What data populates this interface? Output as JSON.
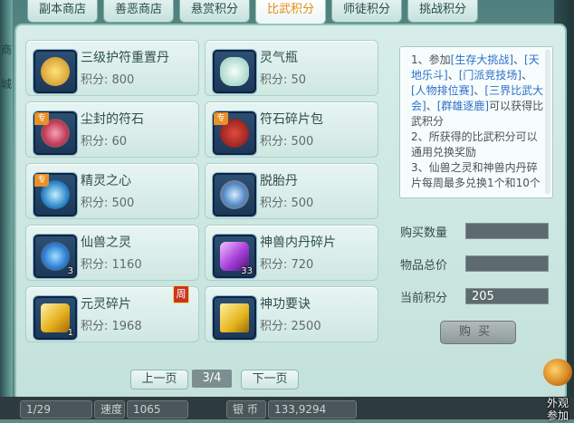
{
  "tabs": [
    "副本商店",
    "善恶商店",
    "悬赏积分",
    "比武积分",
    "师徒积分",
    "挑战积分"
  ],
  "active_tab": "比武积分",
  "side_text": [
    "商",
    "城"
  ],
  "items": [
    {
      "name": "三级护符重置丹",
      "price": "积分: 800",
      "tag": "",
      "qty": "",
      "weekly": "",
      "icon": "gold-amulet-icon",
      "color": "#e0a52a"
    },
    {
      "name": "灵气瓶",
      "price": "积分: 50",
      "tag": "",
      "qty": "",
      "weekly": "",
      "icon": "spirit-bottle-icon",
      "color": "#b9e6d9"
    },
    {
      "name": "尘封的符石",
      "price": "积分: 60",
      "tag": "专",
      "qty": "",
      "weekly": "",
      "icon": "sealed-rune-stone-icon",
      "color": "#d95a76"
    },
    {
      "name": "符石碎片包",
      "price": "积分: 500",
      "tag": "专",
      "qty": "",
      "weekly": "",
      "icon": "rune-shard-bag-icon",
      "color": "#b3262a"
    },
    {
      "name": "精灵之心",
      "price": "积分: 500",
      "tag": "专",
      "qty": "",
      "weekly": "",
      "icon": "spirit-heart-icon",
      "color": "#3f9bd0"
    },
    {
      "name": "脱胎丹",
      "price": "积分: 500",
      "tag": "",
      "qty": "",
      "weekly": "",
      "icon": "rebirth-pill-icon",
      "color": "#4e86c4"
    },
    {
      "name": "仙兽之灵",
      "price": "积分: 1160",
      "tag": "",
      "qty": "3",
      "weekly": "",
      "icon": "immortal-beast-orb-icon",
      "color": "#3b87d9"
    },
    {
      "name": "神兽内丹碎片",
      "price": "积分: 720",
      "tag": "",
      "qty": "33",
      "weekly": "",
      "icon": "beast-core-shard-icon",
      "color": "#a63fd9"
    },
    {
      "name": "元灵碎片",
      "price": "积分: 1968",
      "tag": "",
      "qty": "1",
      "weekly": "周",
      "icon": "yuanling-shard-icon",
      "color": "#e6b21f"
    },
    {
      "name": "神功要诀",
      "price": "积分: 2500",
      "tag": "",
      "qty": "",
      "weekly": "",
      "icon": "skill-manual-icon",
      "color": "#e5b51e"
    }
  ],
  "info": {
    "line1_prefix": "1、参加",
    "l1_a": "[生存大挑战]",
    "l1_sep": "、",
    "l1_b": "[天地乐斗]",
    "l1_c": "[门派竞技场]",
    "l1_d": "[人物排位赛]",
    "l1_e": "[三界比武大会]",
    "l1_f": "[群雄逐鹿]",
    "l1_suffix": "可以获得比武积分",
    "line2": "2、所获得的比武积分可以通用兑换奖励",
    "line3": "3、仙兽之灵和神兽内丹碎片每周最多兑换1个和10个"
  },
  "form": {
    "qty_label": "购买数量",
    "qty_value": "",
    "total_label": "物品总价",
    "total_value": "",
    "points_label": "当前积分",
    "points_value": "205",
    "buy_label": "购买"
  },
  "pager": {
    "prev": "上一页",
    "indicator": "3/4",
    "next": "下一页"
  },
  "bottom": {
    "level": "1/29",
    "speed_label": "速度",
    "speed_value": "1065",
    "money_label": "银 币",
    "money_value": "133,9294"
  },
  "appearance": {
    "label1": "外观",
    "label2": "参加"
  }
}
